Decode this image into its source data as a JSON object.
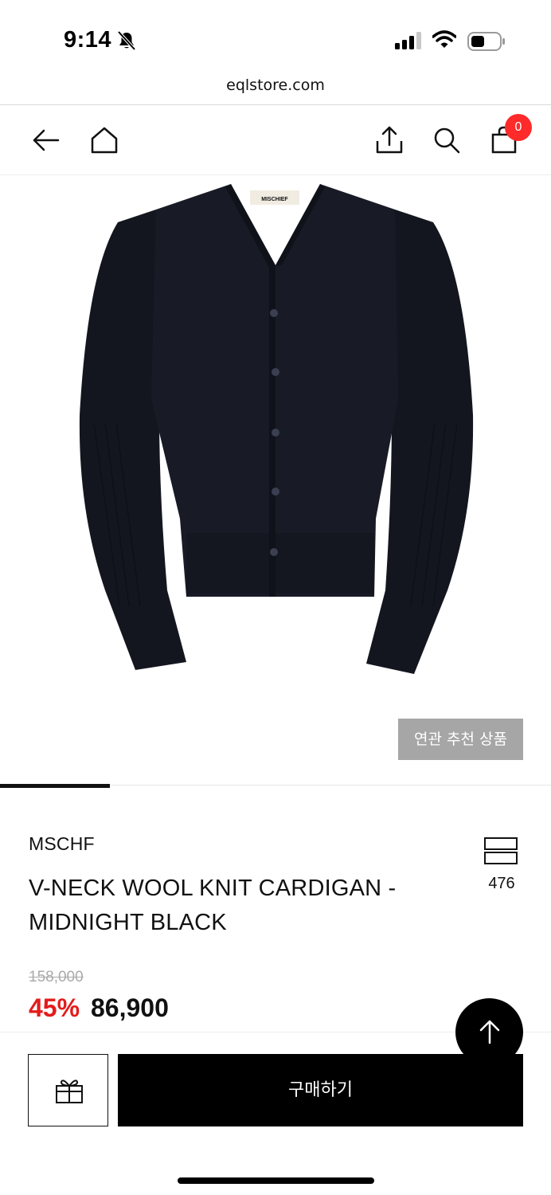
{
  "status_bar": {
    "time": "9:14"
  },
  "browser": {
    "url": "eqlstore.com"
  },
  "header": {
    "cart_count": "0"
  },
  "product": {
    "image_label": "MISCHIEF",
    "related_button_label": "연관 추천 상품",
    "brand": "MSCHF",
    "title": "V-NECK WOOL KNIT CARDIGAN - MIDNIGHT BLACK",
    "view_count": "476",
    "original_price": "158,000",
    "discount_rate": "45%",
    "sale_price": "86,900",
    "image_slider_progress": 0.2
  },
  "bottom_bar": {
    "buy_label": "구매하기"
  },
  "icons": {
    "back": "back-arrow-icon",
    "home": "home-icon",
    "share": "share-icon",
    "search": "search-icon",
    "cart": "shopping-bag-icon",
    "gift": "gift-icon",
    "view_toggle": "view-toggle-icon",
    "scroll_top": "arrow-up-icon"
  },
  "colors": {
    "badge": "#ff2a2a",
    "discount": "#e21c1c",
    "related_button": "#a6a6a6",
    "product": "#14161f"
  }
}
